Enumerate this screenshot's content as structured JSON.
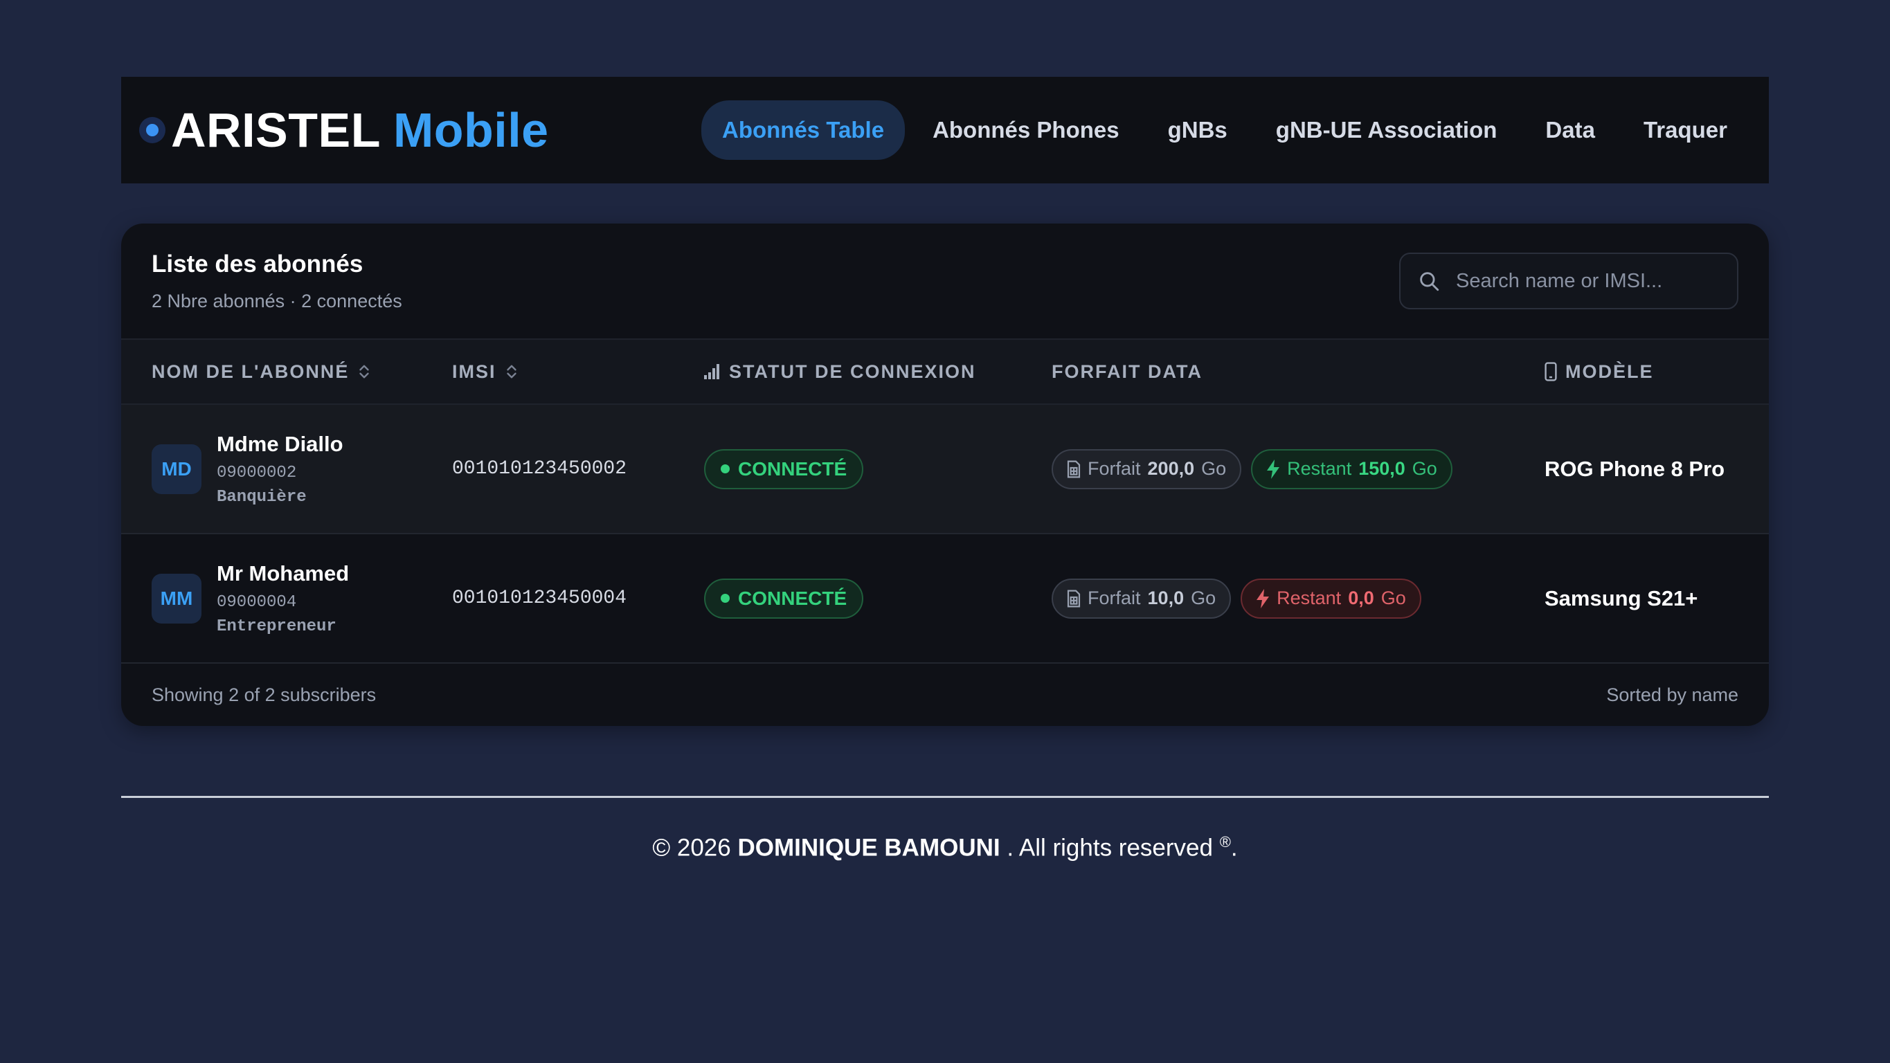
{
  "brand": {
    "name_a": "ARISTEL",
    "name_b": "Mobile"
  },
  "nav": [
    {
      "label": "Abonnés Table",
      "active": true
    },
    {
      "label": "Abonnés Phones",
      "active": false
    },
    {
      "label": "gNBs",
      "active": false
    },
    {
      "label": "gNB-UE Association",
      "active": false
    },
    {
      "label": "Data",
      "active": false
    },
    {
      "label": "Traquer",
      "active": false
    }
  ],
  "card": {
    "title": "Liste des abonnés",
    "subtitle": "2 Nbre abonnés · 2 connectés",
    "search_placeholder": "Search name or IMSI..."
  },
  "table": {
    "headers": {
      "name": "NOM DE L'ABONNÉ",
      "imsi": "IMSI",
      "status": "STATUT DE CONNEXION",
      "plan": "FORFAIT DATA",
      "model": "MODÈLE"
    },
    "rows": [
      {
        "initials": "MD",
        "name": "Mdme Diallo",
        "number": "09000002",
        "job": "Banquière",
        "imsi": "001010123450002",
        "status": "CONNECTÉ",
        "plan_label": "Forfait",
        "plan_value": "200,0",
        "plan_unit": "Go",
        "remain_label": "Restant",
        "remain_value": "150,0",
        "remain_unit": "Go",
        "remain_state": "ok",
        "model": "ROG Phone 8 Pro"
      },
      {
        "initials": "MM",
        "name": "Mr Mohamed",
        "number": "09000004",
        "job": "Entrepreneur",
        "imsi": "001010123450004",
        "status": "CONNECTÉ",
        "plan_label": "Forfait",
        "plan_value": "10,0",
        "plan_unit": "Go",
        "remain_label": "Restant",
        "remain_value": "0,0",
        "remain_unit": "Go",
        "remain_state": "empty",
        "model": "Samsung S21+"
      }
    ]
  },
  "card_footer": {
    "showing": "Showing 2 of 2 subscribers",
    "sorted": "Sorted by name"
  },
  "footer": {
    "prefix": "© 2026",
    "owner": "DOMINIQUE BAMOUNI",
    "suffix": ". All rights reserved",
    "mark": "®",
    "end": "."
  },
  "colors": {
    "background": "#1e2640",
    "accent": "#3ba0f5",
    "connected": "#34d27d",
    "depleted": "#f06a72"
  }
}
